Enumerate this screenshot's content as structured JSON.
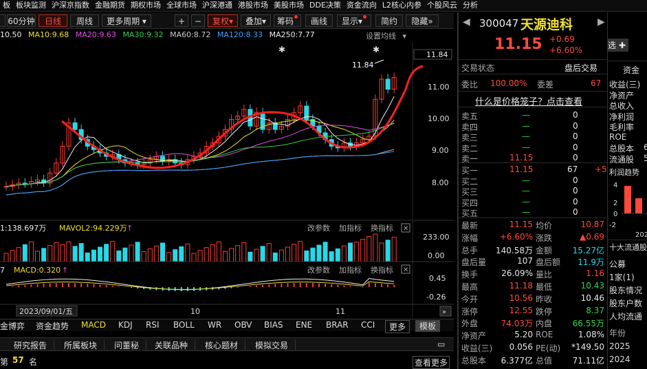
{
  "menu": [
    "板",
    "板块监测",
    "沪深京指数",
    "金融期货",
    "期权市场",
    "全球市场",
    "沪深港通",
    "港股市场",
    "美股市场",
    "DDE决策",
    "资金流向",
    "L2核心内参",
    "个股风云",
    "分析"
  ],
  "toolbar": {
    "period_60": "60分钟",
    "daily": "日线",
    "weekly": "周线",
    "more_period": "更多周期",
    "plus": "+",
    "minus": "−",
    "fq": "复权",
    "overlay": "叠加",
    "chips": "筹码",
    "draw": "画线",
    "display": "显示",
    "simple": "简约",
    "hide": "隐藏"
  },
  "ma": {
    "ma5": "10.50",
    "ma10": "MA10:9.68",
    "ma20": "MA20:9.63",
    "ma30": "MA30:9.32",
    "ma60": "MA60:8.72",
    "ma120": "MA120:8.33",
    "ma250": "MA250:7.77",
    "settings": "设置均线"
  },
  "price_axis": {
    "current": "11.84",
    "t1": "11.00",
    "t2": "10.00",
    "t3": "9.00",
    "t4": "8.00"
  },
  "annot_high": "11.84",
  "vol": {
    "label": "1:138.697万",
    "mavol2": "MAVOL2:94.229万",
    "change_param": "改参数",
    "add_ind": "加指标",
    "switch_ind": "换指标",
    "axis_top": "233.00",
    "axis_bot": "0.00"
  },
  "macd": {
    "label": "7",
    "macd": "MACD:0.320",
    "change_param": "改参数",
    "add_ind": "加指标",
    "switch_ind": "换指标",
    "axis_top": "0.45",
    "axis_bot": "-0.26"
  },
  "date_axis": {
    "cursor": "2023/09/01/五",
    "m10": "10",
    "m11": "11"
  },
  "ind_tabs": [
    "金博弈",
    "资金趋势",
    "MACD",
    "KDJ",
    "RSI",
    "BOLL",
    "WR",
    "OBV",
    "BIAS",
    "ENE",
    "BRAR",
    "CCI"
  ],
  "ind_more": "更多",
  "ind_template": "模板",
  "bottom_tabs": [
    "研究报告",
    "所属板块",
    "问董秘",
    "关联品种",
    "核心题材",
    "模拟交易"
  ],
  "rank": {
    "prefix": "第",
    "value": "57",
    "suffix": "名",
    "view_more": "查看更多"
  },
  "stock": {
    "code": "300047",
    "name": "天源迪科",
    "price": "11.15",
    "change": "+0.69",
    "pct": "+6.60%",
    "add_watch": "自选"
  },
  "quote": {
    "status_label": "交易状态",
    "status_value": "盘后交易",
    "weibi_label": "委比",
    "weibi_value": "100.00%",
    "weicha_label": "委差",
    "weicha_value": "67",
    "link": "什么是价格笼子？点击查看",
    "asks": [
      {
        "label": "卖五",
        "price": "—",
        "vol": "0"
      },
      {
        "label": "卖四",
        "price": "—",
        "vol": "0"
      },
      {
        "label": "卖三",
        "price": "—",
        "vol": "0"
      },
      {
        "label": "卖二",
        "price": "—",
        "vol": "0"
      },
      {
        "label": "卖一",
        "price": "11.15",
        "vol": "0"
      }
    ],
    "bids": [
      {
        "label": "买一",
        "price": "11.15",
        "vol": "67",
        "extra": "+5"
      },
      {
        "label": "买二",
        "price": "—",
        "vol": "0",
        "extra": ""
      },
      {
        "label": "买三",
        "price": "—",
        "vol": "0",
        "extra": ""
      },
      {
        "label": "买四",
        "price": "—",
        "vol": "0",
        "extra": ""
      },
      {
        "label": "买五",
        "price": "—",
        "vol": "0",
        "extra": ""
      }
    ],
    "stats": [
      [
        "最新",
        "11.15",
        "均价",
        "10.87"
      ],
      [
        "涨幅",
        "+6.60%",
        "涨跌",
        "▲0.69"
      ],
      [
        "总手",
        "140.58万",
        "金额",
        "15.27亿"
      ],
      [
        "盘后量",
        "107",
        "盘后额",
        "11.9万"
      ],
      [
        "换手",
        "26.09%",
        "量比",
        "1.16"
      ],
      [
        "最高",
        "11.18",
        "最低",
        "10.43"
      ],
      [
        "今开",
        "10.56",
        "昨收",
        "10.46"
      ],
      [
        "涨停",
        "12.55",
        "跌停",
        "8.37"
      ],
      [
        "外盘",
        "74.03万",
        "内盘",
        "66.55万"
      ],
      [
        "净资产",
        "5.20",
        "ROE",
        "1.08%"
      ],
      [
        "收益(三)",
        "0.056",
        "PE(动)",
        "*149.50"
      ],
      [
        "总股本",
        "6.377亿",
        "总值",
        "71.11亿"
      ]
    ]
  },
  "right": {
    "tab": "资金",
    "rows": [
      "收益(三)",
      "净资产",
      "总收入",
      "净利润",
      "毛利率",
      "ROE",
      "总股本",
      "流通股"
    ],
    "vals": [
      "",
      "",
      "",
      "",
      "",
      "",
      "6",
      "5"
    ],
    "trend": "利润趋势",
    "y": [
      "4",
      "2",
      "0",
      "-2"
    ],
    "year_lbl": "202",
    "holders_title": "十大流通股",
    "holders": [
      "公募",
      "1家(1)",
      "股东情况",
      "股东户数",
      "人均流通"
    ],
    "hold_vals": [
      "",
      "0",
      "",
      "",
      ""
    ],
    "year_header": "年份",
    "years": [
      "2025",
      "2024"
    ]
  }
}
